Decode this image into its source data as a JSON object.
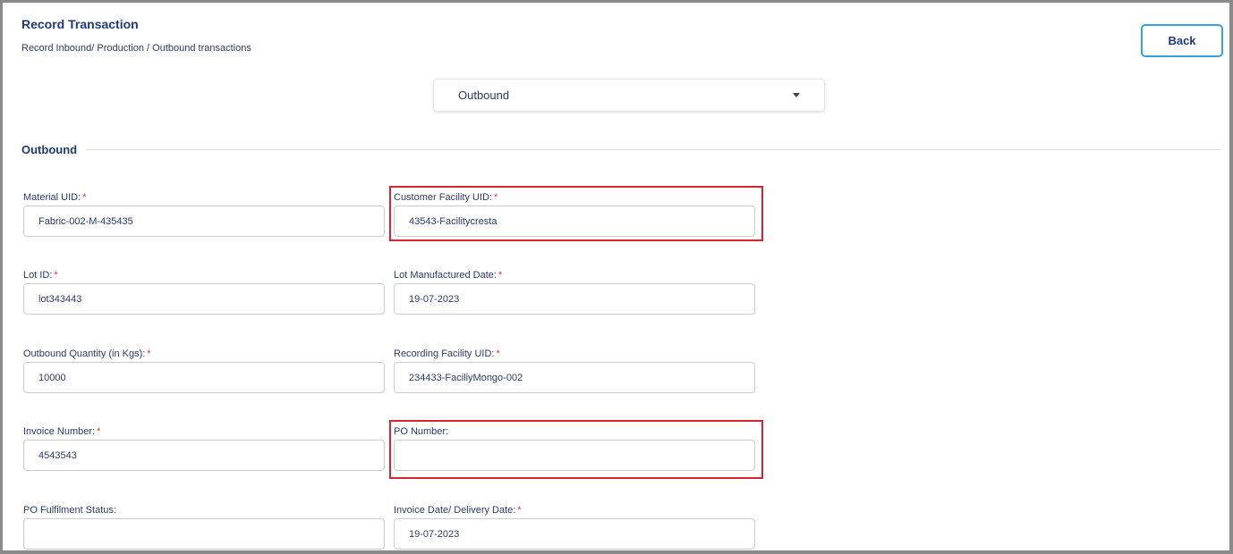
{
  "header": {
    "title": "Record Transaction",
    "subtitle": "Record Inbound/ Production / Outbound transactions",
    "back_label": "Back"
  },
  "transaction_type": {
    "selected": "Outbound"
  },
  "section": {
    "title": "Outbound"
  },
  "fields": {
    "material_uid": {
      "label": "Material UID:",
      "required": "*",
      "value": "Fabric-002-M-435435"
    },
    "customer_facility_uid": {
      "label": "Customer Facility UID:",
      "required": "*",
      "value": "43543-Facilitycresta"
    },
    "lot_id": {
      "label": "Lot ID:",
      "required": "*",
      "value": "lot343443"
    },
    "lot_manufactured_date": {
      "label": "Lot Manufactured Date:",
      "required": "*",
      "value": "19-07-2023"
    },
    "outbound_quantity": {
      "label": "Outbound Quantity (in Kgs):",
      "required": "*",
      "value": "10000"
    },
    "recording_facility_uid": {
      "label": "Recording Facility UID:",
      "required": "*",
      "value": "234433-FaciliyMongo-002"
    },
    "invoice_number": {
      "label": "Invoice Number:",
      "required": "*",
      "value": "4543543"
    },
    "po_number": {
      "label": "PO Number:",
      "value": ""
    },
    "po_fulfilment_status": {
      "label": "PO Fulfilment Status:",
      "value": ""
    },
    "invoice_date": {
      "label": "Invoice Date/ Delivery Date:",
      "required": "*",
      "value": "19-07-2023"
    }
  },
  "colors": {
    "accent": "#1f3a7a",
    "required": "#e0342e",
    "highlight": "#d9232d",
    "back_border": "#3aa0d8"
  }
}
